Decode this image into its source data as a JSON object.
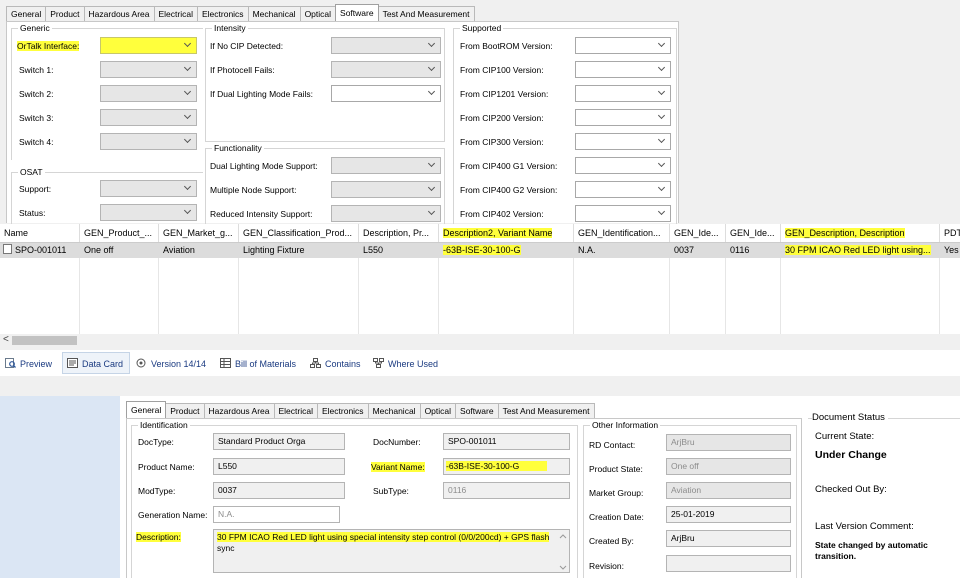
{
  "top_tabs": [
    "General",
    "Product",
    "Hazardous Area",
    "Electrical",
    "Electronics",
    "Mechanical",
    "Optical",
    "Software",
    "Test And Measurement"
  ],
  "top_active_tab": "Software",
  "generic": {
    "title": "Generic",
    "fields": [
      "OrTalk Interface:",
      "Switch 1:",
      "Switch 2:",
      "Switch 3:",
      "Switch 4:"
    ]
  },
  "osat": {
    "title": "OSAT",
    "fields": [
      "Support:",
      "Status:"
    ]
  },
  "intensity": {
    "title": "Intensity",
    "fields": [
      "If No CIP Detected:",
      "If Photocell Fails:",
      "If Dual Lighting Mode Fails:"
    ]
  },
  "functionality": {
    "title": "Functionality",
    "fields": [
      "Dual Lighting Mode Support:",
      "Multiple Node Support:",
      "Reduced Intensity Support:"
    ]
  },
  "supported": {
    "title": "Supported",
    "fields": [
      "From BootROM Version:",
      "From CIP100 Version:",
      "From CIP1201 Version:",
      "From CIP200 Version:",
      "From CIP300 Version:",
      "From CIP400 G1 Version:",
      "From CIP400 G2 Version:",
      "From CIP402 Version:"
    ]
  },
  "grid": {
    "headers": [
      "Name",
      "GEN_Product_...",
      "GEN_Market_g...",
      "GEN_Classification_Prod...",
      "Description, Pr...",
      "Description2, Variant Name",
      "GEN_Identification...",
      "GEN_Ide...",
      "GEN_Ide...",
      "GEN_Description, Description",
      "PDT"
    ],
    "row": [
      "SPO-001011",
      "One off",
      "Aviation",
      "Lighting Fixture",
      "L550",
      "-63B-ISE-30-100-G",
      "N.A.",
      "0037",
      "0116",
      "30 FPM ICAO Red LED light using...",
      "Yes"
    ]
  },
  "scroll_left_glyph": "<",
  "view_tabs": [
    "Preview",
    "Data Card",
    "Version 14/14",
    "Bill of Materials",
    "Contains",
    "Where Used"
  ],
  "card_tabs": [
    "General",
    "Product",
    "Hazardous Area",
    "Electrical",
    "Electronics",
    "Mechanical",
    "Optical",
    "Software",
    "Test And Measurement"
  ],
  "card_active_tab": "General",
  "identification": {
    "title": "Identification",
    "doctype_label": "DocType:",
    "doctype": "Standard Product Orga",
    "docnumber_label": "DocNumber:",
    "docnumber": "SPO-001011",
    "product_name_label": "Product Name:",
    "product_name": "L550",
    "variant_name_label": "Variant Name:",
    "variant_name": "-63B-ISE-30-100-G",
    "modtype_label": "ModType:",
    "modtype": "0037",
    "subtype_label": "SubType:",
    "subtype": "0116",
    "generation_name_label": "Generation Name:",
    "generation_name": "N.A.",
    "description_label": "Description:",
    "description_line1": "30 FPM ICAO Red LED light using special intensity step control (0/0/200cd) + GPS flash",
    "description_line2": "sync"
  },
  "other_info": {
    "title": "Other Information",
    "rd_contact_label": "RD Contact:",
    "rd_contact": "ArjBru",
    "product_state_label": "Product State:",
    "product_state": "One off",
    "market_group_label": "Market Group:",
    "market_group": "Aviation",
    "creation_date_label": "Creation Date:",
    "creation_date": "25-01-2019",
    "created_by_label": "Created By:",
    "created_by": "ArjBru",
    "revision_label": "Revision:",
    "revision": ""
  },
  "doc_status": {
    "title": "Document Status",
    "current_state_label": "Current State:",
    "current_state": "Under Change",
    "checked_out_label": "Checked Out By:",
    "last_comment_label": "Last Version Comment:",
    "last_comment_line1": "State changed by automatic",
    "last_comment_line2": "transition."
  },
  "colors": {
    "highlight": "#ffff3c",
    "link": "#1a3a80",
    "selected_row": "#dcdcdc"
  }
}
